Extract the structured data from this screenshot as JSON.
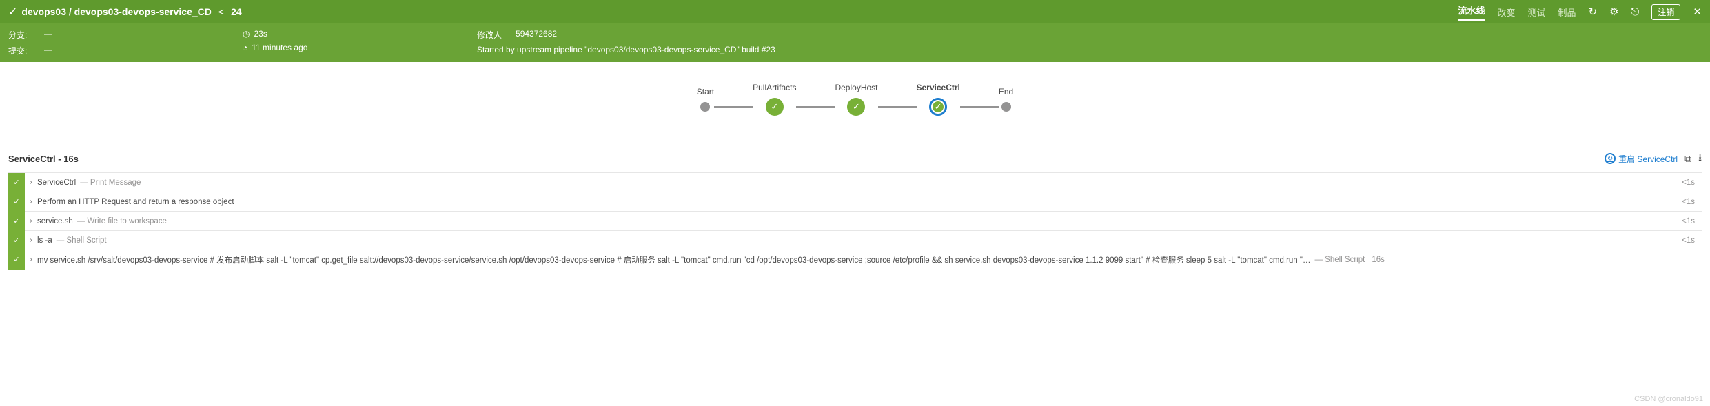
{
  "header": {
    "breadcrumb": "devops03 / devops03-devops-service_CD",
    "run_prev_arrow": "<",
    "run_number": "24",
    "tabs": {
      "pipeline": "流水线",
      "changes": "改变",
      "tests": "测试",
      "artifacts": "制品"
    },
    "register_label": "注销"
  },
  "info": {
    "branch_label": "分支:",
    "branch_value": "—",
    "commit_label": "提交:",
    "commit_value": "—",
    "duration": "23s",
    "age": "11 minutes ago",
    "modifier_label": "修改人",
    "modifier_value": "594372682",
    "started_by": "Started by upstream pipeline \"devops03/devops03-devops-service_CD\" build #23"
  },
  "stages": {
    "start": "Start",
    "pull": "PullArtifacts",
    "deploy": "DeployHost",
    "service": "ServiceCtrl",
    "end": "End"
  },
  "steps_header": {
    "title": "ServiceCtrl - 16s",
    "restart_label": "重启 ServiceCtrl"
  },
  "steps": [
    {
      "name": "ServiceCtrl",
      "desc": "— Print Message",
      "dur": "<1s"
    },
    {
      "name": "Perform an HTTP Request and return a response object",
      "desc": "",
      "dur": "<1s"
    },
    {
      "name": "service.sh",
      "desc": "— Write file to workspace",
      "dur": "<1s"
    },
    {
      "name": "ls -a",
      "desc": "— Shell Script",
      "dur": "<1s"
    },
    {
      "name": "mv service.sh /srv/salt/devops03-devops-service # 发布启动脚本 salt -L \"tomcat\" cp.get_file salt://devops03-devops-service/service.sh /opt/devops03-devops-service # 启动服务 salt -L \"tomcat\" cmd.run \"cd /opt/devops03-devops-service ;source /etc/profile && sh service.sh devops03-devops-service 1.1.2 9099 start\" # 检查服务 sleep 5 salt -L \"tomcat\" cmd.run \"…",
      "desc": "— Shell Script",
      "dur": "16s"
    }
  ],
  "watermark": "CSDN @cronaldo91"
}
